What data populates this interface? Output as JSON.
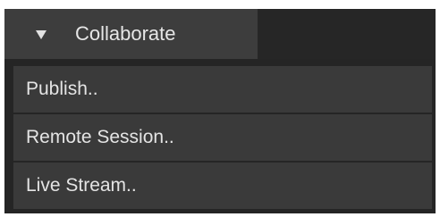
{
  "panel": {
    "tab": {
      "label": "Collaborate",
      "icon": "triangle-down-icon"
    },
    "menu": {
      "items": [
        {
          "label": "Publish.."
        },
        {
          "label": "Remote Session.."
        },
        {
          "label": "Live Stream.."
        }
      ]
    }
  },
  "colors": {
    "panel_bg": "#252525",
    "tab_bg": "#3d3d3d",
    "item_bg": "#3a3a3a",
    "text": "#e4e4e4"
  }
}
